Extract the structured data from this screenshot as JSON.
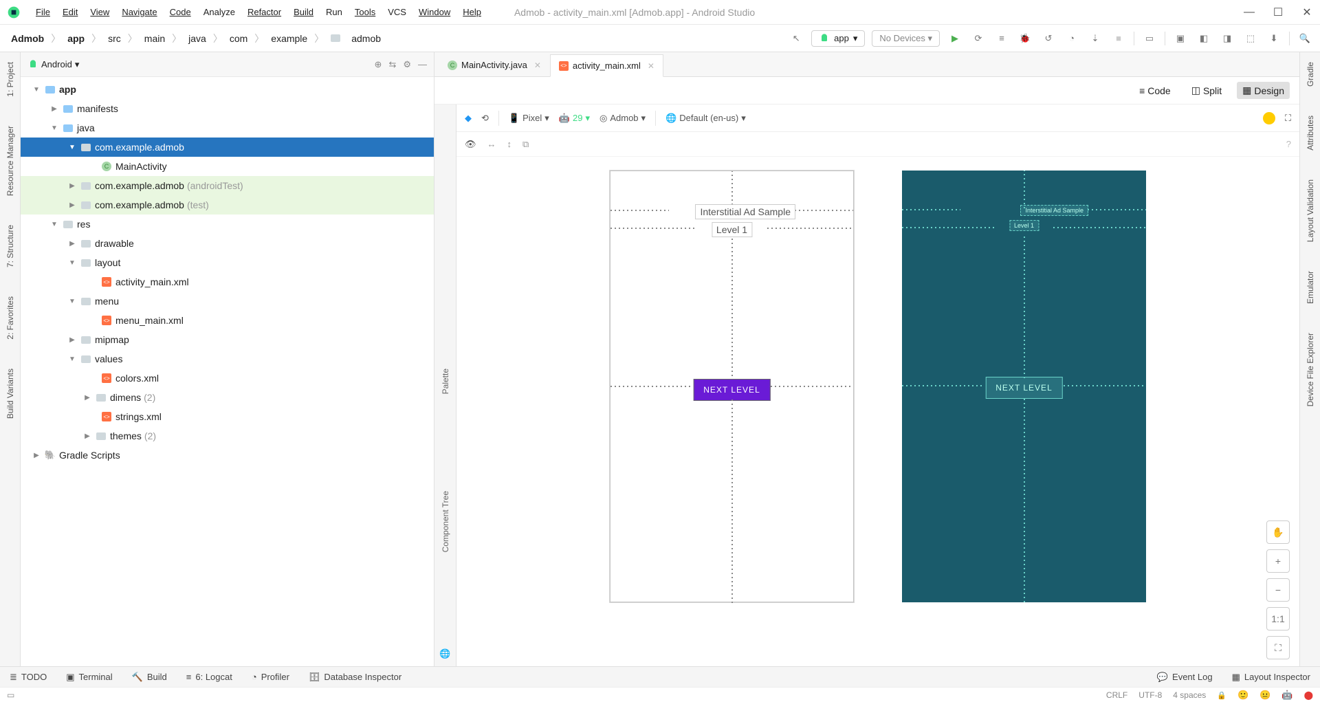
{
  "window": {
    "title": "Admob - activity_main.xml [Admob.app] - Android Studio"
  },
  "menus": {
    "file": "File",
    "edit": "Edit",
    "view": "View",
    "navigate": "Navigate",
    "code": "Code",
    "analyze": "Analyze",
    "refactor": "Refactor",
    "build": "Build",
    "run": "Run",
    "tools": "Tools",
    "vcs": "VCS",
    "window": "Window",
    "help": "Help"
  },
  "breadcrumbs": [
    "Admob",
    "app",
    "src",
    "main",
    "java",
    "com",
    "example",
    "admob"
  ],
  "toolbar": {
    "run_config": "app",
    "device": "No Devices"
  },
  "project": {
    "selector": "Android",
    "tree": {
      "app": "app",
      "manifests": "manifests",
      "java": "java",
      "pkg_main": "com.example.admob",
      "main_activity": "MainActivity",
      "pkg_android_test": "com.example.admob",
      "pkg_android_test_hint": "(androidTest)",
      "pkg_test": "com.example.admob",
      "pkg_test_hint": "(test)",
      "res": "res",
      "drawable": "drawable",
      "layout": "layout",
      "activity_main": "activity_main.xml",
      "menu": "menu",
      "menu_main": "menu_main.xml",
      "mipmap": "mipmap",
      "values": "values",
      "colors": "colors.xml",
      "dimens": "dimens",
      "dimens_hint": "(2)",
      "strings": "strings.xml",
      "themes": "themes",
      "themes_hint": "(2)",
      "gradle": "Gradle Scripts"
    }
  },
  "tabs": {
    "tab1": "MainActivity.java",
    "tab2": "activity_main.xml"
  },
  "viewmode": {
    "code": "Code",
    "split": "Split",
    "design": "Design"
  },
  "design_toolbar": {
    "device": "Pixel",
    "api": "29",
    "theme": "Admob",
    "locale": "Default (en-us)"
  },
  "design_surface": {
    "title": "Interstitial Ad Sample",
    "level": "Level 1",
    "button": "NEXT LEVEL"
  },
  "zoom": {
    "fit": "1:1"
  },
  "left_rail": {
    "project": "1: Project",
    "resmgr": "Resource Manager",
    "structure": "7: Structure",
    "favorites": "2: Favorites",
    "buildvar": "Build Variants"
  },
  "right_rail": {
    "gradle": "Gradle",
    "attrs": "Attributes",
    "layoutval": "Layout Validation",
    "emulator": "Emulator",
    "devexp": "Device File Explorer"
  },
  "palette": {
    "palette": "Palette",
    "comptree": "Component Tree"
  },
  "bottom": {
    "todo": "TODO",
    "terminal": "Terminal",
    "build": "Build",
    "logcat": "6: Logcat",
    "profiler": "Profiler",
    "db": "Database Inspector",
    "eventlog": "Event Log",
    "layoutinsp": "Layout Inspector"
  },
  "status": {
    "line_ending": "CRLF",
    "encoding": "UTF-8",
    "indent": "4 spaces"
  }
}
